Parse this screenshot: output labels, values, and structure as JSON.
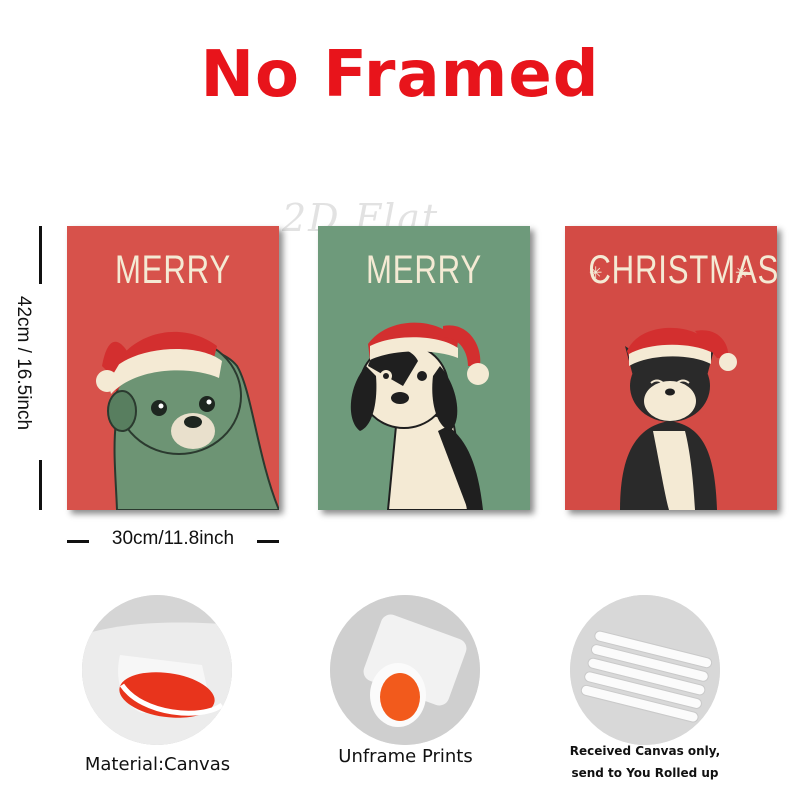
{
  "headline": "No Framed",
  "watermark": "2D Flat",
  "posters": [
    {
      "title": "MERRY",
      "background": "#d7524b",
      "animal": "pug-icon"
    },
    {
      "title": "MERRY",
      "background": "#6e9a7b",
      "animal": "dog-icon"
    },
    {
      "title": "CHRISTMAS",
      "background": "#d34b45",
      "animal": "cat-icon"
    }
  ],
  "dimensions": {
    "height": "42cm / 16.5inch",
    "width": "30cm/11.8inch"
  },
  "features": [
    {
      "caption": "Material:Canvas",
      "icon": "canvas-roll-icon"
    },
    {
      "caption": "Unframe Prints",
      "icon": "rolled-print-icon"
    },
    {
      "caption_line1": "Received Canvas only,",
      "caption_line2": "send to You Rolled up",
      "icon": "packaged-rolls-icon"
    }
  ],
  "colors": {
    "headline": "#e8141b",
    "hat": "#d32f2f",
    "cream": "#f4ead4"
  }
}
